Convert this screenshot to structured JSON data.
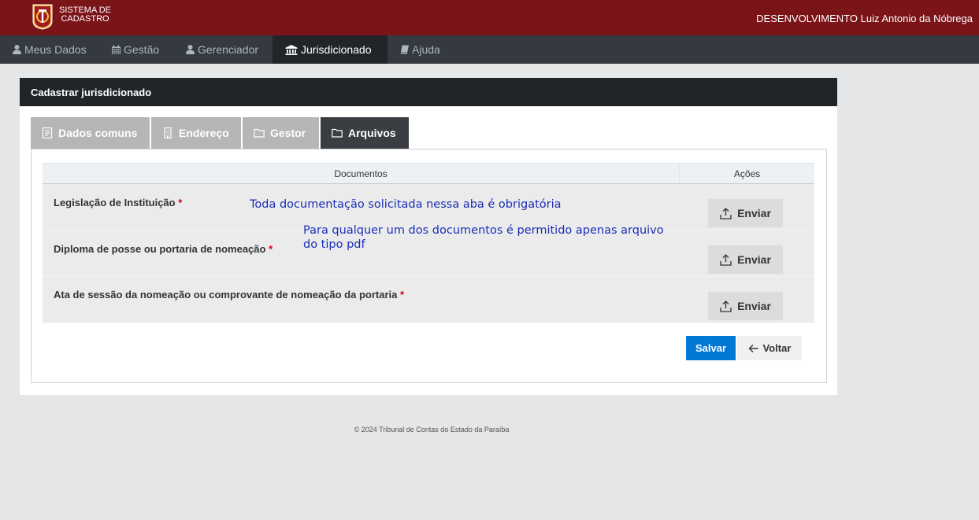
{
  "header": {
    "system_line1": "SISTEMA DE",
    "system_line2": "CADASTRO",
    "user": "DESENVOLVIMENTO Luiz Antonio da Nóbrega"
  },
  "nav": {
    "items": [
      {
        "label": "Meus Dados",
        "icon": "user-icon"
      },
      {
        "label": "Gestão",
        "icon": "calendar-icon"
      },
      {
        "label": "Gerenciador",
        "icon": "user-icon"
      },
      {
        "label": "Jurisdicionado",
        "icon": "bank-icon",
        "active": true
      },
      {
        "label": "Ajuda",
        "icon": "book-icon"
      }
    ]
  },
  "panel": {
    "title": "Cadastrar jurisdicionado"
  },
  "tabs": [
    {
      "label": "Dados comuns",
      "icon": "document-icon"
    },
    {
      "label": "Endereço",
      "icon": "building-icon"
    },
    {
      "label": "Gestor",
      "icon": "folder-icon"
    },
    {
      "label": "Arquivos",
      "icon": "folder-icon",
      "active": true
    }
  ],
  "table": {
    "headers": [
      "Documentos",
      "Ações"
    ],
    "rows": [
      {
        "label": "Legislação de Instituição",
        "required": "*",
        "action": "Enviar"
      },
      {
        "label": "Diploma de posse ou portaria de nomeação",
        "required": "*",
        "action": "Enviar"
      },
      {
        "label": "Ata de sessão da nomeação ou comprovante de nomeação da portaria",
        "required": "*",
        "action": "Enviar"
      }
    ]
  },
  "notes": {
    "note1": "Toda documentação solicitada nessa aba é obrigatória",
    "note2_line1": "Para qualquer um dos documentos é permitido apenas arquivo",
    "note2_line2": "do tipo pdf"
  },
  "buttons": {
    "save": "Salvar",
    "back": "Voltar"
  },
  "footer": "© 2024 Tribunal de Contas do Estado da Paraíba",
  "colors": {
    "topbar": "#7b1419",
    "nav": "#343a40",
    "primary": "#0078d4",
    "required": "#d0021b",
    "note": "#1a2eb8"
  }
}
